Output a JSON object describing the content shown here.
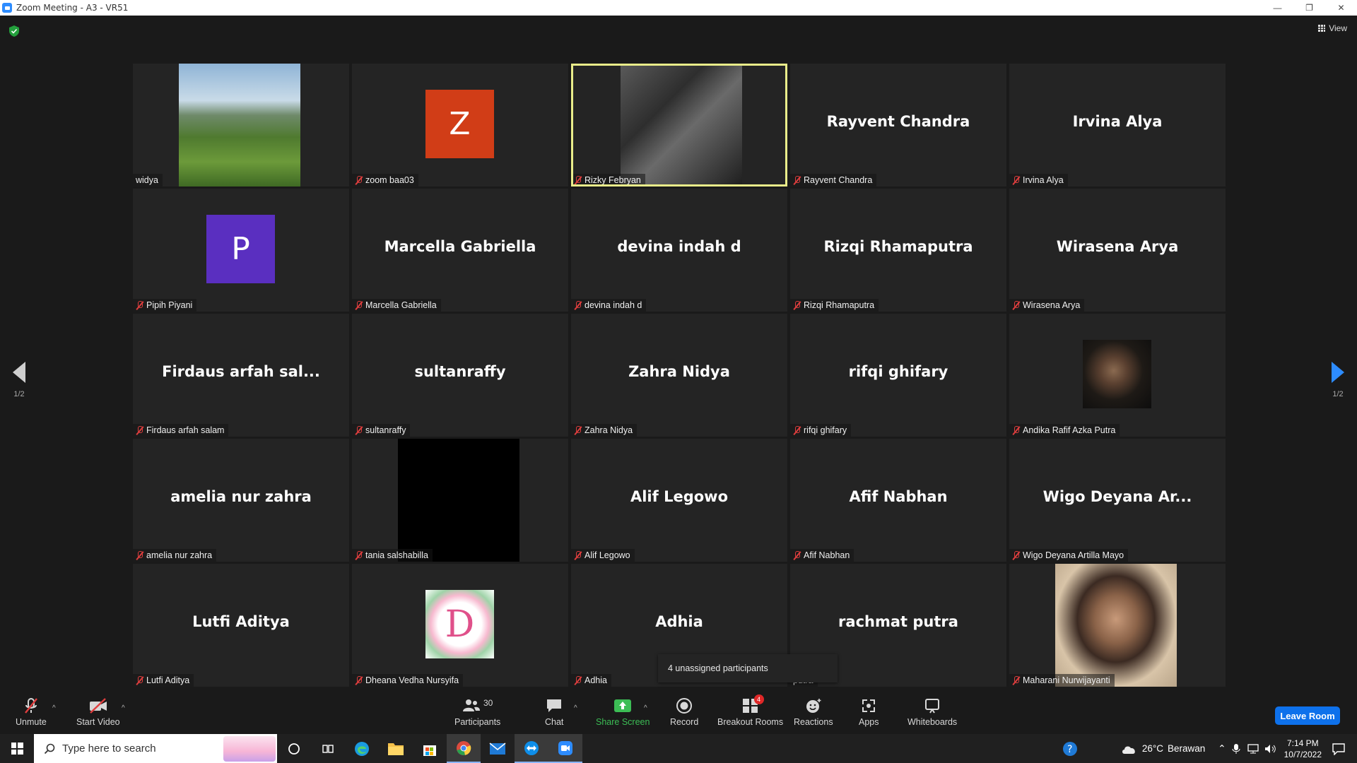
{
  "window": {
    "title": "Zoom Meeting - A3 - VR51",
    "minimize": "—",
    "restore": "❐",
    "close": "✕"
  },
  "top": {
    "view_label": "View",
    "page_left": "1/2",
    "page_right": "1/2"
  },
  "participants": [
    {
      "display": "",
      "label": "widya",
      "muted": false,
      "type": "image-landscape"
    },
    {
      "display": "Z",
      "label": "zoom baa03",
      "muted": true,
      "type": "letter",
      "color": "#d13d17"
    },
    {
      "display": "",
      "label": "Rizky Febryan",
      "muted": true,
      "type": "image-video",
      "active": true
    },
    {
      "display": "Rayvent Chandra",
      "label": "Rayvent Chandra",
      "muted": true,
      "type": "name"
    },
    {
      "display": "Irvina Alya",
      "label": "Irvina Alya",
      "muted": true,
      "type": "name"
    },
    {
      "display": "P",
      "label": "Pipih Piyani",
      "muted": true,
      "type": "letter",
      "color": "#5a2fc0"
    },
    {
      "display": "Marcella Gabriella",
      "label": "Marcella Gabriella",
      "muted": true,
      "type": "name"
    },
    {
      "display": "devina indah d",
      "label": "devina indah d",
      "muted": true,
      "type": "name"
    },
    {
      "display": "Rizqi Rhamaputra",
      "label": "Rizqi Rhamaputra",
      "muted": true,
      "type": "name"
    },
    {
      "display": "Wirasena Arya",
      "label": "Wirasena Arya",
      "muted": true,
      "type": "name"
    },
    {
      "display": "Firdaus arfah sal...",
      "label": "Firdaus arfah salam",
      "muted": true,
      "type": "name"
    },
    {
      "display": "sultanraffy",
      "label": "sultanraffy",
      "muted": true,
      "type": "name"
    },
    {
      "display": "Zahra Nidya",
      "label": "Zahra Nidya",
      "muted": true,
      "type": "name"
    },
    {
      "display": "rifqi ghifary",
      "label": "rifqi ghifary",
      "muted": true,
      "type": "name"
    },
    {
      "display": "",
      "label": "Andika Rafif Azka Putra",
      "muted": true,
      "type": "image-person-dark"
    },
    {
      "display": "amelia nur zahra",
      "label": "amelia nur zahra",
      "muted": true,
      "type": "name"
    },
    {
      "display": "",
      "label": "tania salshabilla",
      "muted": true,
      "type": "image-black"
    },
    {
      "display": "Alif Legowo",
      "label": "Alif Legowo",
      "muted": true,
      "type": "name"
    },
    {
      "display": "Afif Nabhan",
      "label": "Afif Nabhan",
      "muted": true,
      "type": "name"
    },
    {
      "display": "Wigo  Deyana  Ar...",
      "label": "Wigo Deyana Artilla Mayo",
      "muted": true,
      "type": "name"
    },
    {
      "display": "Lutfi Aditya",
      "label": "Lutfi Aditya",
      "muted": true,
      "type": "name"
    },
    {
      "display": "",
      "label": "Dheana Vedha Nursyifa",
      "muted": true,
      "type": "image-floral"
    },
    {
      "display": "Adhia",
      "label": "Adhia",
      "muted": true,
      "type": "name"
    },
    {
      "display": "rachmat putra",
      "label": "putra",
      "muted": false,
      "type": "name"
    },
    {
      "display": "",
      "label": "Maharani Nurwijayanti",
      "muted": true,
      "type": "image-person-light"
    }
  ],
  "tooltip": "4 unassigned participants",
  "toolbar": {
    "unmute": "Unmute",
    "start_video": "Start Video",
    "participants": "Participants",
    "participant_count": "30",
    "chat": "Chat",
    "share_screen": "Share Screen",
    "record": "Record",
    "breakout_rooms": "Breakout Rooms",
    "breakout_badge": "4",
    "reactions": "Reactions",
    "apps": "Apps",
    "whiteboards": "Whiteboards",
    "leave": "Leave Room"
  },
  "taskbar": {
    "search_placeholder": "Type here to search",
    "weather_temp": "26°C",
    "weather_desc": "Berawan",
    "time": "7:14 PM",
    "date": "10/7/2022"
  },
  "colors": {
    "accent": "#2d8cff",
    "active_border": "#e9ec8a",
    "leave": "#0e71eb",
    "muted": "#e03e3e",
    "share": "#3cbd55"
  }
}
